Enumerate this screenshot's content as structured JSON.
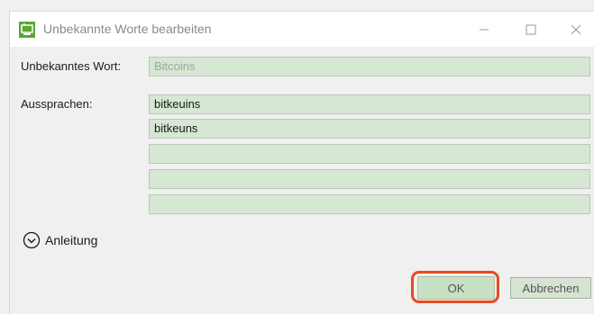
{
  "window": {
    "title": "Unbekannte Worte bearbeiten",
    "icon": "app-icon",
    "controls": [
      "minimize-icon",
      "maximize-icon",
      "close-icon"
    ]
  },
  "form": {
    "word_label": "Unbekanntes Wort:",
    "word_value": "Bitcoins",
    "pronunciations_label": "Aussprachen:",
    "pronunciations": [
      "bitkeuins",
      "bitkeuns",
      "",
      "",
      ""
    ]
  },
  "guide": {
    "label": "Anleitung",
    "icon": "chevron-down-circle-icon"
  },
  "buttons": {
    "ok": "OK",
    "cancel": "Abbrechen"
  },
  "colors": {
    "field_bg": "#d6e8d3",
    "highlight": "#e84a1e"
  }
}
